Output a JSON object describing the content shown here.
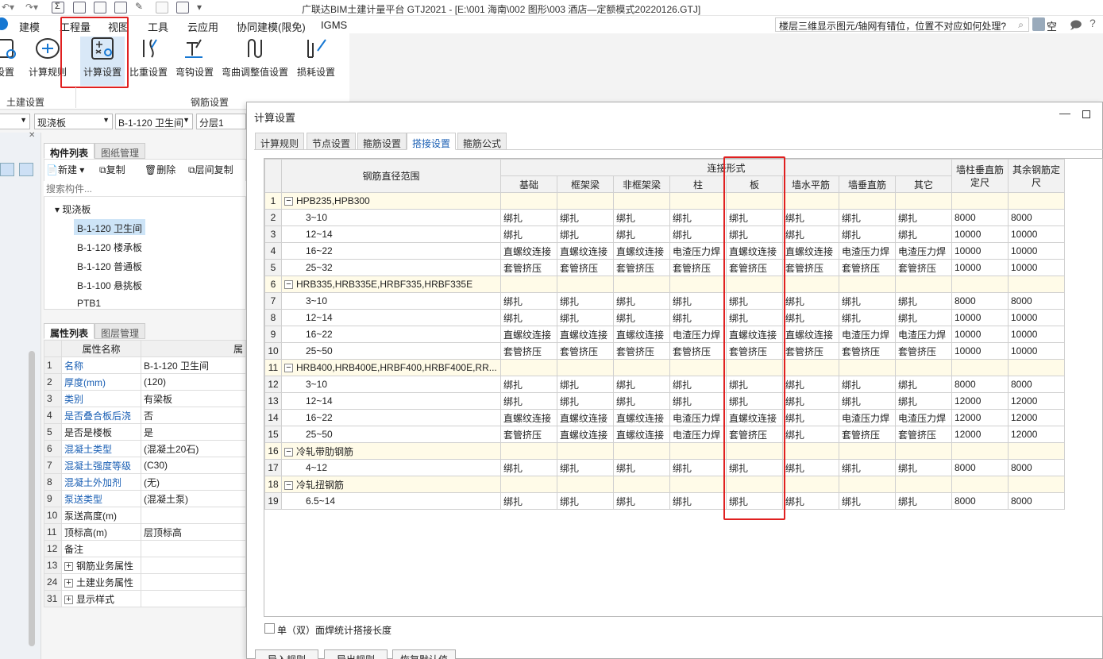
{
  "app_title": "广联达BIM土建计量平台 GTJ2021 - [E:\\001 海南\\002 图形\\003 酒店—定额模式20220126.GTJ]",
  "menu": [
    "建模",
    "工程量",
    "视图",
    "工具",
    "云应用",
    "协同建模(限免)",
    "IGMS"
  ],
  "search_hint": "楼层三维显示图元/轴网有错位，位置不对应如何处理?",
  "user_label": "空",
  "ribbon": {
    "buttons": [
      "设置",
      "计算规则",
      "计算设置",
      "比重设置",
      "弯钩设置",
      "弯曲调整值设置",
      "损耗设置"
    ],
    "groups": [
      "土建设置",
      "钢筋设置"
    ]
  },
  "left": {
    "combo_type": "现浇板",
    "combo_member": "B-1-120 卫生间",
    "combo_floor": "分层1",
    "tabs_top": [
      "构件列表",
      "图纸管理"
    ],
    "toolbar": [
      "新建",
      "复制",
      "删除",
      "层间复制"
    ],
    "search_placeholder": "搜索构件...",
    "tree_root": "现浇板",
    "tree_items": [
      "B-1-120 卫生间",
      "B-1-120 楼承板",
      "B-1-120 普通板",
      "B-1-100 悬挑板",
      "PTB1"
    ],
    "tabs_prop": [
      "属性列表",
      "图层管理"
    ],
    "prop_header": [
      "属性名称",
      "属"
    ],
    "props": [
      {
        "n": "1",
        "name": "名称",
        "val": "B-1-120 卫生间",
        "blue": true
      },
      {
        "n": "2",
        "name": "厚度(mm)",
        "val": "(120)",
        "blue": true
      },
      {
        "n": "3",
        "name": "类别",
        "val": "有梁板",
        "blue": true
      },
      {
        "n": "4",
        "name": "是否叠合板后浇",
        "val": "否",
        "blue": true
      },
      {
        "n": "5",
        "name": "是否是楼板",
        "val": "是",
        "blue": false
      },
      {
        "n": "6",
        "name": "混凝土类型",
        "val": "(混凝土20石)",
        "blue": true
      },
      {
        "n": "7",
        "name": "混凝土强度等级",
        "val": "(C30)",
        "blue": true
      },
      {
        "n": "8",
        "name": "混凝土外加剂",
        "val": "(无)",
        "blue": true
      },
      {
        "n": "9",
        "name": "泵送类型",
        "val": "(混凝土泵)",
        "blue": true
      },
      {
        "n": "10",
        "name": "泵送高度(m)",
        "val": "",
        "blue": false
      },
      {
        "n": "11",
        "name": "顶标高(m)",
        "val": "层顶标高",
        "blue": false
      },
      {
        "n": "12",
        "name": "备注",
        "val": "",
        "blue": false
      },
      {
        "n": "13",
        "name": "钢筋业务属性",
        "val": "",
        "blue": false,
        "plus": true
      },
      {
        "n": "24",
        "name": "土建业务属性",
        "val": "",
        "blue": false,
        "plus": true
      },
      {
        "n": "31",
        "name": "显示样式",
        "val": "",
        "blue": false,
        "plus": true
      }
    ]
  },
  "dialog": {
    "title": "计算设置",
    "tabs": [
      "计算规则",
      "节点设置",
      "箍筋设置",
      "搭接设置",
      "箍筋公式"
    ],
    "active_tab": 3,
    "header": {
      "range": "钢筋直径范围",
      "conn": "连接形式",
      "cols": [
        "基础",
        "框架梁",
        "非框架梁",
        "柱",
        "板",
        "墙水平筋",
        "墙垂直筋",
        "其它"
      ],
      "wall_col": "墙柱垂直筋定尺",
      "other_col": "其余钢筋定尺"
    },
    "rows": [
      {
        "n": "1",
        "group": true,
        "label": "HPB235,HPB300"
      },
      {
        "n": "2",
        "label": "3~10",
        "v": [
          "绑扎",
          "绑扎",
          "绑扎",
          "绑扎",
          "绑扎",
          "绑扎",
          "绑扎",
          "绑扎",
          "8000",
          "8000"
        ]
      },
      {
        "n": "3",
        "label": "12~14",
        "v": [
          "绑扎",
          "绑扎",
          "绑扎",
          "绑扎",
          "绑扎",
          "绑扎",
          "绑扎",
          "绑扎",
          "10000",
          "10000"
        ]
      },
      {
        "n": "4",
        "label": "16~22",
        "v": [
          "直螺纹连接",
          "直螺纹连接",
          "直螺纹连接",
          "电渣压力焊",
          "直螺纹连接",
          "直螺纹连接",
          "电渣压力焊",
          "电渣压力焊",
          "10000",
          "10000"
        ]
      },
      {
        "n": "5",
        "label": "25~32",
        "v": [
          "套管挤压",
          "套管挤压",
          "套管挤压",
          "套管挤压",
          "套管挤压",
          "套管挤压",
          "套管挤压",
          "套管挤压",
          "10000",
          "10000"
        ]
      },
      {
        "n": "6",
        "group": true,
        "label": "HRB335,HRB335E,HRBF335,HRBF335E"
      },
      {
        "n": "7",
        "label": "3~10",
        "v": [
          "绑扎",
          "绑扎",
          "绑扎",
          "绑扎",
          "绑扎",
          "绑扎",
          "绑扎",
          "绑扎",
          "8000",
          "8000"
        ]
      },
      {
        "n": "8",
        "label": "12~14",
        "v": [
          "绑扎",
          "绑扎",
          "绑扎",
          "绑扎",
          "绑扎",
          "绑扎",
          "绑扎",
          "绑扎",
          "10000",
          "10000"
        ]
      },
      {
        "n": "9",
        "label": "16~22",
        "v": [
          "直螺纹连接",
          "直螺纹连接",
          "直螺纹连接",
          "电渣压力焊",
          "直螺纹连接",
          "直螺纹连接",
          "电渣压力焊",
          "电渣压力焊",
          "10000",
          "10000"
        ]
      },
      {
        "n": "10",
        "label": "25~50",
        "v": [
          "套管挤压",
          "套管挤压",
          "套管挤压",
          "套管挤压",
          "套管挤压",
          "套管挤压",
          "套管挤压",
          "套管挤压",
          "10000",
          "10000"
        ]
      },
      {
        "n": "11",
        "group": true,
        "label": "HRB400,HRB400E,HRBF400,HRBF400E,RR..."
      },
      {
        "n": "12",
        "label": "3~10",
        "v": [
          "绑扎",
          "绑扎",
          "绑扎",
          "绑扎",
          "绑扎",
          "绑扎",
          "绑扎",
          "绑扎",
          "8000",
          "8000"
        ]
      },
      {
        "n": "13",
        "label": "12~14",
        "v": [
          "绑扎",
          "绑扎",
          "绑扎",
          "绑扎",
          "绑扎",
          "绑扎",
          "绑扎",
          "绑扎",
          "12000",
          "12000"
        ]
      },
      {
        "n": "14",
        "label": "16~22",
        "v": [
          "直螺纹连接",
          "直螺纹连接",
          "直螺纹连接",
          "电渣压力焊",
          "直螺纹连接",
          "绑扎",
          "电渣压力焊",
          "电渣压力焊",
          "12000",
          "12000"
        ]
      },
      {
        "n": "15",
        "label": "25~50",
        "v": [
          "套管挤压",
          "直螺纹连接",
          "直螺纹连接",
          "电渣压力焊",
          "套管挤压",
          "绑扎",
          "套管挤压",
          "套管挤压",
          "12000",
          "12000"
        ]
      },
      {
        "n": "16",
        "group": true,
        "label": "冷轧带肋钢筋"
      },
      {
        "n": "17",
        "label": "4~12",
        "v": [
          "绑扎",
          "绑扎",
          "绑扎",
          "绑扎",
          "绑扎",
          "绑扎",
          "绑扎",
          "绑扎",
          "8000",
          "8000"
        ]
      },
      {
        "n": "18",
        "group": true,
        "label": "冷轧扭钢筋"
      },
      {
        "n": "19",
        "label": "6.5~14",
        "v": [
          "绑扎",
          "绑扎",
          "绑扎",
          "绑扎",
          "绑扎",
          "绑扎",
          "绑扎",
          "绑扎",
          "8000",
          "8000"
        ]
      }
    ],
    "checkbox_label": "单（双）面焊统计搭接长度",
    "buttons": [
      "导入规则",
      "导出规则",
      "恢复默认值"
    ]
  }
}
